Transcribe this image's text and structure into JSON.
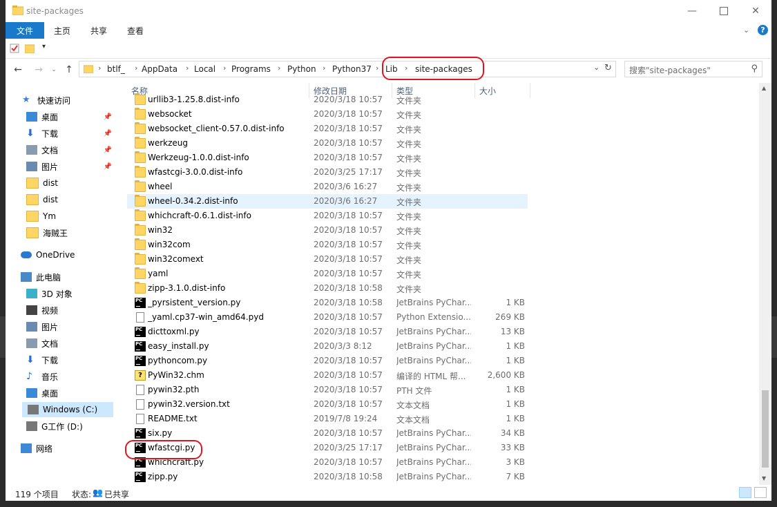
{
  "window": {
    "title": "site-packages"
  },
  "ribbon": {
    "tabs": [
      "文件",
      "主页",
      "共享",
      "查看"
    ]
  },
  "address": {
    "crumbs": [
      "btlf_",
      "AppData",
      "Local",
      "Programs",
      "Python",
      "Python37",
      "Lib",
      "site-packages"
    ]
  },
  "search": {
    "placeholder": "搜索\"site-packages\""
  },
  "nav": {
    "items": [
      {
        "label": "快速访问",
        "icon": "star-icon",
        "pinned": false
      },
      {
        "label": "桌面",
        "icon": "desktop-icon",
        "pinned": true
      },
      {
        "label": "下载",
        "icon": "download-icon",
        "pinned": true
      },
      {
        "label": "文档",
        "icon": "document-icon",
        "pinned": true
      },
      {
        "label": "图片",
        "icon": "pictures-icon",
        "pinned": true
      },
      {
        "label": "dist",
        "icon": "folder-icon",
        "pinned": false
      },
      {
        "label": "dist",
        "icon": "folder-icon",
        "pinned": false
      },
      {
        "label": "Ym",
        "icon": "folder-icon",
        "pinned": false
      },
      {
        "label": "海贼王",
        "icon": "folder-icon",
        "pinned": false
      },
      {
        "label": "OneDrive",
        "icon": "cloud-icon",
        "pinned": false
      },
      {
        "label": "此电脑",
        "icon": "computer-icon",
        "pinned": false
      },
      {
        "label": "3D 对象",
        "icon": "cube-icon",
        "pinned": false
      },
      {
        "label": "视频",
        "icon": "video-icon",
        "pinned": false
      },
      {
        "label": "图片",
        "icon": "pictures-icon",
        "pinned": false
      },
      {
        "label": "文档",
        "icon": "document-icon",
        "pinned": false
      },
      {
        "label": "下载",
        "icon": "download-icon",
        "pinned": false
      },
      {
        "label": "音乐",
        "icon": "music-icon",
        "pinned": false
      },
      {
        "label": "桌面",
        "icon": "desktop-icon",
        "pinned": false
      },
      {
        "label": "Windows (C:)",
        "icon": "drive-icon",
        "pinned": false
      },
      {
        "label": "G工作 (D:)",
        "icon": "drive-icon",
        "pinned": false
      },
      {
        "label": "网络",
        "icon": "network-icon",
        "pinned": false
      }
    ]
  },
  "columns": {
    "name": "名称",
    "date": "修改日期",
    "type": "类型",
    "size": "大小"
  },
  "files": [
    {
      "name": "urllib3-1.25.8.dist-info",
      "date": "2020/3/18 10:57",
      "type": "文件夹",
      "size": "",
      "icon": "folder"
    },
    {
      "name": "websocket",
      "date": "2020/3/18 10:57",
      "type": "文件夹",
      "size": "",
      "icon": "folder"
    },
    {
      "name": "websocket_client-0.57.0.dist-info",
      "date": "2020/3/18 10:57",
      "type": "文件夹",
      "size": "",
      "icon": "folder"
    },
    {
      "name": "werkzeug",
      "date": "2020/3/18 10:57",
      "type": "文件夹",
      "size": "",
      "icon": "folder"
    },
    {
      "name": "Werkzeug-1.0.0.dist-info",
      "date": "2020/3/18 10:57",
      "type": "文件夹",
      "size": "",
      "icon": "folder"
    },
    {
      "name": "wfastcgi-3.0.0.dist-info",
      "date": "2020/3/25 17:17",
      "type": "文件夹",
      "size": "",
      "icon": "folder"
    },
    {
      "name": "wheel",
      "date": "2020/3/6 16:27",
      "type": "文件夹",
      "size": "",
      "icon": "folder"
    },
    {
      "name": "wheel-0.34.2.dist-info",
      "date": "2020/3/6 16:27",
      "type": "文件夹",
      "size": "",
      "icon": "folder"
    },
    {
      "name": "whichcraft-0.6.1.dist-info",
      "date": "2020/3/18 10:57",
      "type": "文件夹",
      "size": "",
      "icon": "folder"
    },
    {
      "name": "win32",
      "date": "2020/3/18 10:57",
      "type": "文件夹",
      "size": "",
      "icon": "folder"
    },
    {
      "name": "win32com",
      "date": "2020/3/18 10:57",
      "type": "文件夹",
      "size": "",
      "icon": "folder"
    },
    {
      "name": "win32comext",
      "date": "2020/3/18 10:57",
      "type": "文件夹",
      "size": "",
      "icon": "folder"
    },
    {
      "name": "yaml",
      "date": "2020/3/18 10:57",
      "type": "文件夹",
      "size": "",
      "icon": "folder"
    },
    {
      "name": "zipp-3.1.0.dist-info",
      "date": "2020/3/18 10:58",
      "type": "文件夹",
      "size": "",
      "icon": "folder"
    },
    {
      "name": "_pyrsistent_version.py",
      "date": "2020/3/18 10:58",
      "type": "JetBrains PyChar...",
      "size": "1 KB",
      "icon": "pycharm"
    },
    {
      "name": "_yaml.cp37-win_amd64.pyd",
      "date": "2020/3/18 10:57",
      "type": "Python Extensio...",
      "size": "269 KB",
      "icon": "doc"
    },
    {
      "name": "dicttoxml.py",
      "date": "2020/3/18 10:57",
      "type": "JetBrains PyChar...",
      "size": "13 KB",
      "icon": "pycharm"
    },
    {
      "name": "easy_install.py",
      "date": "2020/3/3 8:12",
      "type": "JetBrains PyChar...",
      "size": "1 KB",
      "icon": "pycharm"
    },
    {
      "name": "pythoncom.py",
      "date": "2020/3/18 10:57",
      "type": "JetBrains PyChar...",
      "size": "1 KB",
      "icon": "pycharm"
    },
    {
      "name": "PyWin32.chm",
      "date": "2020/3/18 10:57",
      "type": "编译的 HTML 帮...",
      "size": "2,600 KB",
      "icon": "chm"
    },
    {
      "name": "pywin32.pth",
      "date": "2020/3/18 10:57",
      "type": "PTH 文件",
      "size": "1 KB",
      "icon": "doc"
    },
    {
      "name": "pywin32.version.txt",
      "date": "2020/3/18 10:57",
      "type": "文本文档",
      "size": "1 KB",
      "icon": "doc"
    },
    {
      "name": "README.txt",
      "date": "2019/7/8 19:24",
      "type": "文本文档",
      "size": "1 KB",
      "icon": "doc"
    },
    {
      "name": "six.py",
      "date": "2020/3/18 10:57",
      "type": "JetBrains PyChar...",
      "size": "34 KB",
      "icon": "pycharm"
    },
    {
      "name": "wfastcgi.py",
      "date": "2020/3/25 17:17",
      "type": "JetBrains PyChar...",
      "size": "33 KB",
      "icon": "pycharm"
    },
    {
      "name": "whichcraft.py",
      "date": "2020/3/18 10:57",
      "type": "JetBrains PyChar...",
      "size": "3 KB",
      "icon": "pycharm"
    },
    {
      "name": "zipp.py",
      "date": "2020/3/18 10:58",
      "type": "JetBrains PyChar...",
      "size": "7 KB",
      "icon": "pycharm"
    }
  ],
  "status": {
    "count": "119 个项目",
    "state_label": "状态:",
    "state_value": "已共享"
  },
  "colors": {
    "accent": "#1979ca",
    "selection": "#cce8ff",
    "hover": "#e5f3ff",
    "annotation": "#e0141e"
  }
}
